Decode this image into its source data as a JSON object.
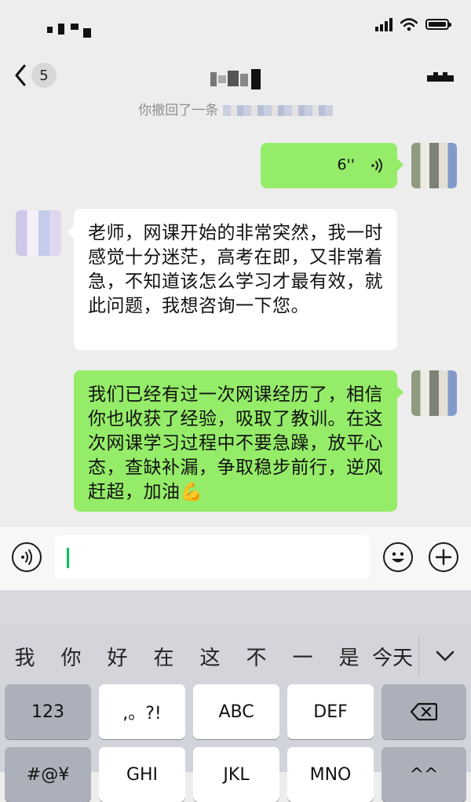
{
  "nav": {
    "back_count": "5"
  },
  "system_message": "你撤回了一条",
  "voice_message": {
    "duration": "6''"
  },
  "messages": [
    {
      "text": "老师，网课开始的非常突然，我一时感觉十分迷茫，高考在即，又非常着急，不知道该怎么学习才最有效，就此问题，我想咨询一下您。"
    },
    {
      "text": "我们已经有过一次网课经历了，相信你也收获了经验，吸取了教训。在这次网课学习过程中不要急躁，放平心态，查缺补漏，争取稳步前行，逆风赶超，加油💪"
    }
  ],
  "keyboard": {
    "candidates": [
      "我",
      "你",
      "好",
      "在",
      "这",
      "不",
      "一",
      "是",
      "今天"
    ],
    "row1": [
      "123",
      ",。?!",
      "ABC",
      "DEF"
    ],
    "row2": [
      "#@¥",
      "GHI",
      "JKL",
      "MNO",
      "^^"
    ]
  },
  "colors": {
    "outgoing_bubble": "#95ec69",
    "incoming_bubble": "#ffffff",
    "chat_bg": "#ededed",
    "cursor": "#07c160"
  }
}
